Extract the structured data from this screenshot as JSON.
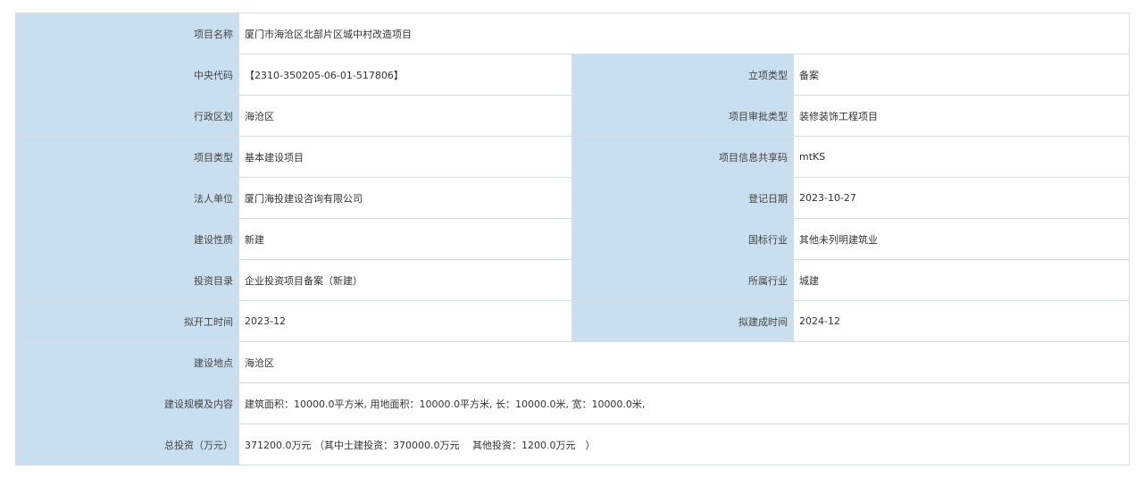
{
  "colors": {
    "label_bg": "#c9dfef",
    "border": "#d6dde4",
    "text": "#333333"
  },
  "rows": [
    {
      "label": "项目名称",
      "value": "厦门市海沧区北部片区城中村改造项目"
    },
    {
      "label": "中央代码",
      "value": "【2310-350205-06-01-517806】",
      "label2": "立项类型",
      "value2": "备案"
    },
    {
      "label": "行政区划",
      "value": "海沧区",
      "label2": "项目审批类型",
      "value2": "装修装饰工程项目"
    },
    {
      "label": "项目类型",
      "value": "基本建设项目",
      "label2": "项目信息共享码",
      "value2": "mtKS"
    },
    {
      "label": "法人单位",
      "value": "厦门海投建设咨询有限公司",
      "label2": "登记日期",
      "value2": "2023-10-27"
    },
    {
      "label": "建设性质",
      "value": "新建",
      "label2": "国标行业",
      "value2": "其他未列明建筑业"
    },
    {
      "label": "投资目录",
      "value": "企业投资项目备案（新建）",
      "label2": "所属行业",
      "value2": "城建"
    },
    {
      "label": "拟开工时间",
      "value": "2023-12",
      "label2": "拟建成时间",
      "value2": "2024-12"
    },
    {
      "label": "建设地点",
      "value": "海沧区"
    },
    {
      "label": "建设规模及内容",
      "value": "建筑面积：10000.0平方米, 用地面积：10000.0平方米, 长：10000.0米, 宽：10000.0米,"
    },
    {
      "label": "总投资（万元）",
      "value": "371200.0万元 （其中土建投资：370000.0万元　 其他投资：1200.0万元　）"
    }
  ]
}
